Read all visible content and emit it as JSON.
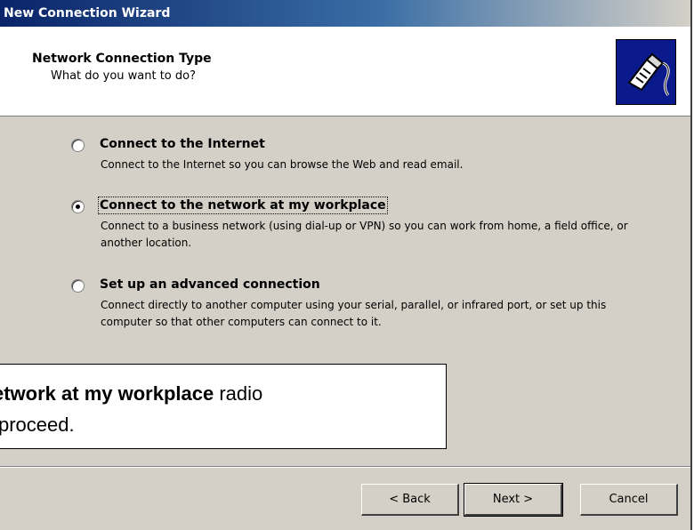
{
  "window": {
    "title": "New Connection Wizard"
  },
  "header": {
    "title": "Network Connection Type",
    "subtitle": "What do you want to do?",
    "icon": "network-connection-icon"
  },
  "options": [
    {
      "label": "Connect to the Internet",
      "description": "Connect to the Internet so you can browse the Web and read email.",
      "checked": false
    },
    {
      "label": "Connect to the network at my workplace",
      "description": "Connect to a business network (using dial-up or VPN) so you can work from home, a field office, or another location.",
      "checked": true
    },
    {
      "label": "Set up an advanced connection",
      "description": "Connect directly to another computer using your serial, parallel, or infrared port, or set up this computer so that other computers can connect to it.",
      "checked": false
    }
  ],
  "callout": {
    "bold_text": "etwork at my workplace",
    "text_after": " radio",
    "line2": "proceed."
  },
  "buttons": {
    "back": "< Back",
    "next": "Next >",
    "cancel": "Cancel"
  },
  "colors": {
    "titlebar": "#0a246a",
    "face": "#d4d0c8",
    "logo_bg": "#0a1a8c"
  }
}
